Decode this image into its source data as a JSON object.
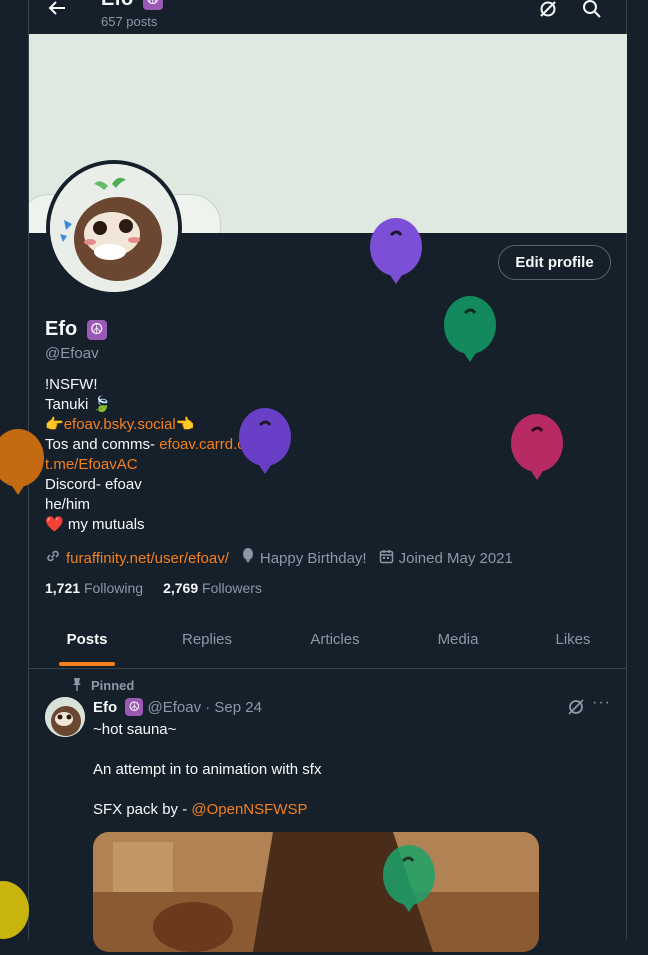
{
  "header": {
    "name": "Efo",
    "emoji": "☮️",
    "posts": "657 posts"
  },
  "profile": {
    "name": "Efo",
    "emoji": "☮",
    "handle": "@Efoav",
    "edit_label": "Edit profile",
    "bio": {
      "line1": "!NSFW!",
      "line2_text": "Tanuki",
      "line2_emoji": "🍃",
      "line3_pre": "👉",
      "line3_link": "efoav.bsky.social",
      "line3_post": "👈",
      "line4_text": "Tos and comms- ",
      "line4_link": "efoav.carrd.co",
      "line5_link": "t.me/EfoavAC",
      "line6": "Discord- efoav",
      "line7": "he/him",
      "line8_heart": "❤️",
      "line8_text": " my mutuals"
    },
    "website": "furaffinity.net/user/efoav/",
    "birthday": "Happy Birthday!",
    "joined": "Joined May 2021",
    "following_count": "1,721",
    "following_label": "Following",
    "followers_count": "2,769",
    "followers_label": "Followers"
  },
  "tabs": [
    "Posts",
    "Replies",
    "Articles",
    "Media",
    "Likes"
  ],
  "tweet": {
    "pinned_label": "Pinned",
    "author": "Efo",
    "emoji": "☮",
    "handle_date": "@Efoav · Sep 24",
    "line1": "~hot sauna~",
    "line2": "An attempt in to animation with sfx",
    "line3_text": "SFX pack by - ",
    "line3_link": "@OpenNSFWSP",
    "more": "···"
  },
  "colors": {
    "background": "#15202b",
    "accent": "#f4801e",
    "muted": "#8b98a5"
  }
}
